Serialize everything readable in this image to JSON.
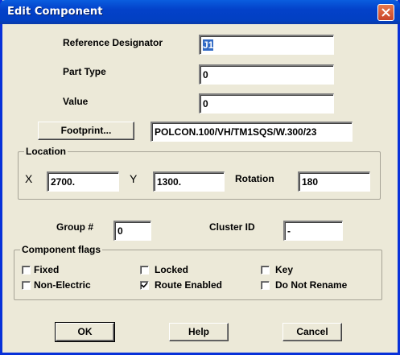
{
  "window": {
    "title": "Edit Component"
  },
  "fields": {
    "reference_designator": {
      "label": "Reference Designator",
      "value": "J1"
    },
    "part_type": {
      "label": "Part Type",
      "value": "0"
    },
    "value": {
      "label": "Value",
      "value": "0"
    },
    "footprint": {
      "button_label": "Footprint...",
      "value": "POLCON.100/VH/TM1SQS/W.300/23"
    }
  },
  "location": {
    "caption": "Location",
    "x_label": "X",
    "x_value": "2700.",
    "y_label": "Y",
    "y_value": "1300.",
    "rotation_label": "Rotation",
    "rotation_value": "180"
  },
  "group": {
    "label": "Group #",
    "value": "0"
  },
  "cluster": {
    "label": "Cluster ID",
    "value": "-"
  },
  "flags": {
    "caption": "Component flags",
    "items": [
      {
        "label": "Fixed",
        "checked": false
      },
      {
        "label": "Locked",
        "checked": false
      },
      {
        "label": "Key",
        "checked": false
      },
      {
        "label": "Non-Electric",
        "checked": false
      },
      {
        "label": "Route Enabled",
        "checked": true
      },
      {
        "label": "Do Not Rename",
        "checked": false
      }
    ]
  },
  "buttons": {
    "ok": "OK",
    "help": "Help",
    "cancel": "Cancel"
  },
  "colors": {
    "titlebar": "#0341c9",
    "face": "#ece9d8",
    "selection": "#316ac5"
  }
}
